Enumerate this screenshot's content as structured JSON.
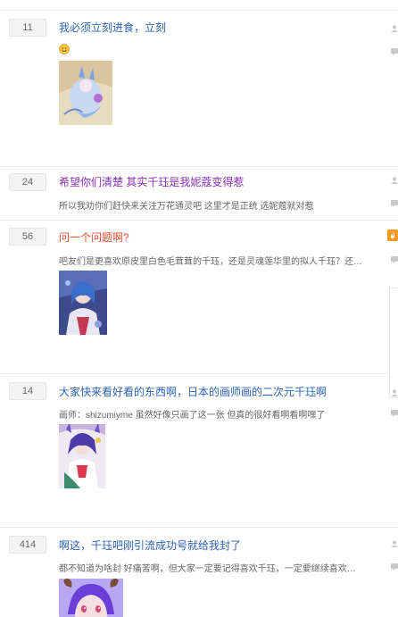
{
  "colors": {
    "link": "#2d64b3",
    "visited": "#8a2fb6",
    "hot": "#e14f2e",
    "badge_bg": "#f3f3f3",
    "excerpt": "#666666"
  },
  "posts": [
    {
      "replies": "11",
      "title": "我必须立刻进食，立刻",
      "title_state": "link",
      "excerpt": "",
      "has_emoji": true,
      "emoji": "smile-icon",
      "image": "anime-art-white-fox"
    },
    {
      "replies": "24",
      "title": "希望你们清楚 其实千珏是我妮蔻变得惹",
      "title_state": "visited",
      "excerpt": "所以我劝你们赶快来关注万花通灵吧 这里才是正统 选妮蔻就对惹",
      "image": ""
    },
    {
      "replies": "56",
      "title": "问一个问题啊?",
      "title_state": "hot",
      "excerpt": "吧友们是更喜欢原皮里白色毛茸茸的千珏，还是灵魂莲华里的拟人千珏？还有...",
      "image": "anime-art-blue-hair"
    },
    {
      "replies": "14",
      "title": "大家快来看好看的东西啊，日本的画师画的二次元千珏啊",
      "title_state": "link",
      "excerpt": "画师：shizumiyme 虽然好像只画了这一张 但真的很好看啊看啊嘿了",
      "image": "anime-art-kindred-girl"
    },
    {
      "replies": "414",
      "title": "啊这，千珏吧刚引流成功号就给我封了",
      "title_state": "link",
      "excerpt": "都不知道为啥封 好痛苦啊，但大家一定要记得喜欢千珏，一定要继续喜欢下...",
      "image": "anime-art-purple-hair"
    }
  ],
  "icons": {
    "author": "user-icon",
    "last_reply": "comment-icon",
    "hot": "fire-flag-icon"
  }
}
